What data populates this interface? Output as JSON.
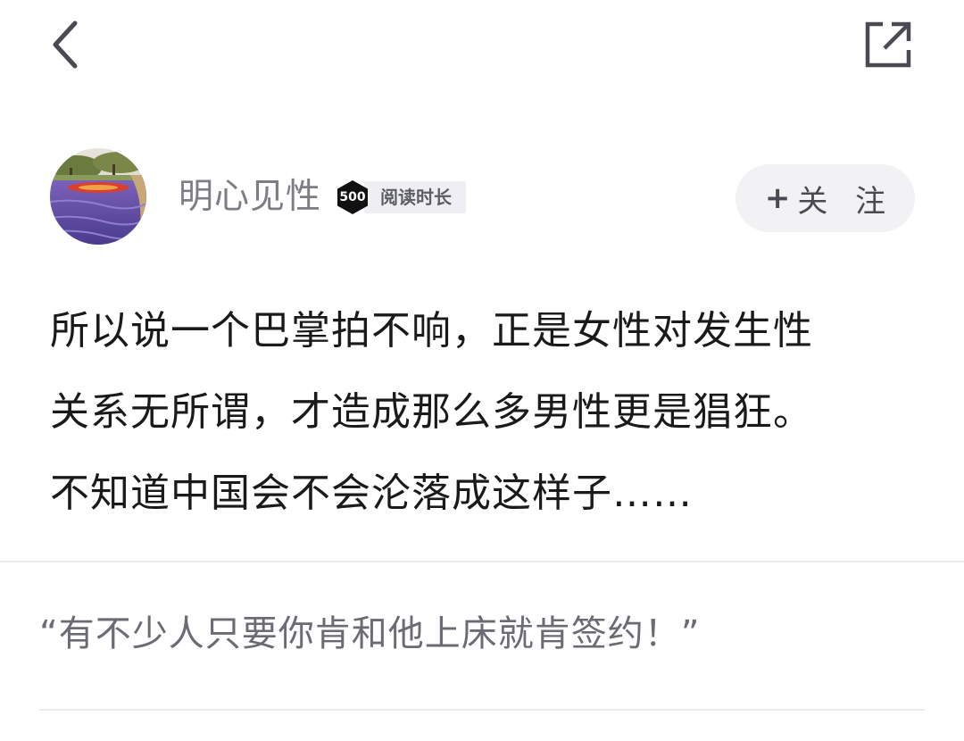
{
  "header": {
    "back_icon": "chevron-left-icon",
    "share_icon": "external-link-icon"
  },
  "author": {
    "name": "明心见性",
    "badge_number": "500",
    "badge_label": "阅读时长",
    "badge_color": "#111111"
  },
  "follow_button": {
    "plus": "+",
    "label": "关 注"
  },
  "post": {
    "lines": [
      "所以说一个巴掌拍不响，正是女性对发生性",
      "关系无所谓，才造成那么多男性更是猖狂。",
      "不知道中国会不会沦落成这样子……"
    ]
  },
  "quote": {
    "text": "“有不少人只要你肯和他上床就肯签约！”"
  }
}
